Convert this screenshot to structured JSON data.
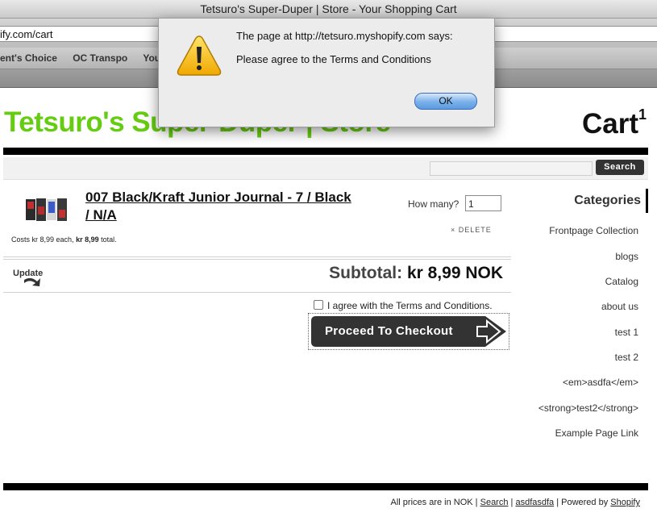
{
  "browser": {
    "window_title": "Tetsuro's Super-Duper | Store - Your Shopping Cart",
    "url": "ify.com/cart",
    "bookmarks": [
      "ent's Choice",
      "OC Transpo",
      "YouT"
    ]
  },
  "dialog": {
    "message_title": "The page at http://tetsuro.myshopify.com says:",
    "message_body": "Please agree to the Terms and Conditions",
    "ok_label": "OK",
    "icon": "warning-icon"
  },
  "store": {
    "title": "Tetsuro's Super-Duper | Store",
    "cart_label": "Cart",
    "cart_count": "1",
    "search_button": "Search"
  },
  "cart": {
    "item": {
      "title": "007 Black/Kraft Junior Journal - 7 / Black / N/A",
      "howmany_label": "How many?",
      "quantity": "1",
      "delete_label": "× DELETE",
      "costs_prefix": "Costs kr 8,99 each,",
      "costs_total": "kr 8,99",
      "costs_suffix": "total."
    },
    "update_label": "Update",
    "subtotal_label": "Subtotal:",
    "subtotal_value": "kr 8,99 NOK",
    "agree_label": "I agree with the Terms and Conditions.",
    "checkout_label": "Proceed To Checkout"
  },
  "sidebar": {
    "heading": "Categories",
    "items": [
      "Frontpage Collection",
      "blogs",
      "Catalog",
      "about us",
      "test 1",
      "test 2",
      "<em>asdfa</em>",
      "<strong>test2</strong>",
      "Example Page Link"
    ]
  },
  "footer": {
    "prices_text": "All prices are in NOK |",
    "search_link": "Search",
    "sep1": "|",
    "asdf_link": "asdfasdfa",
    "powered_text": "| Powered by",
    "shopify_link": "Shopify"
  },
  "colors": {
    "brand_green": "#66cc11",
    "button_dark": "#333333"
  }
}
